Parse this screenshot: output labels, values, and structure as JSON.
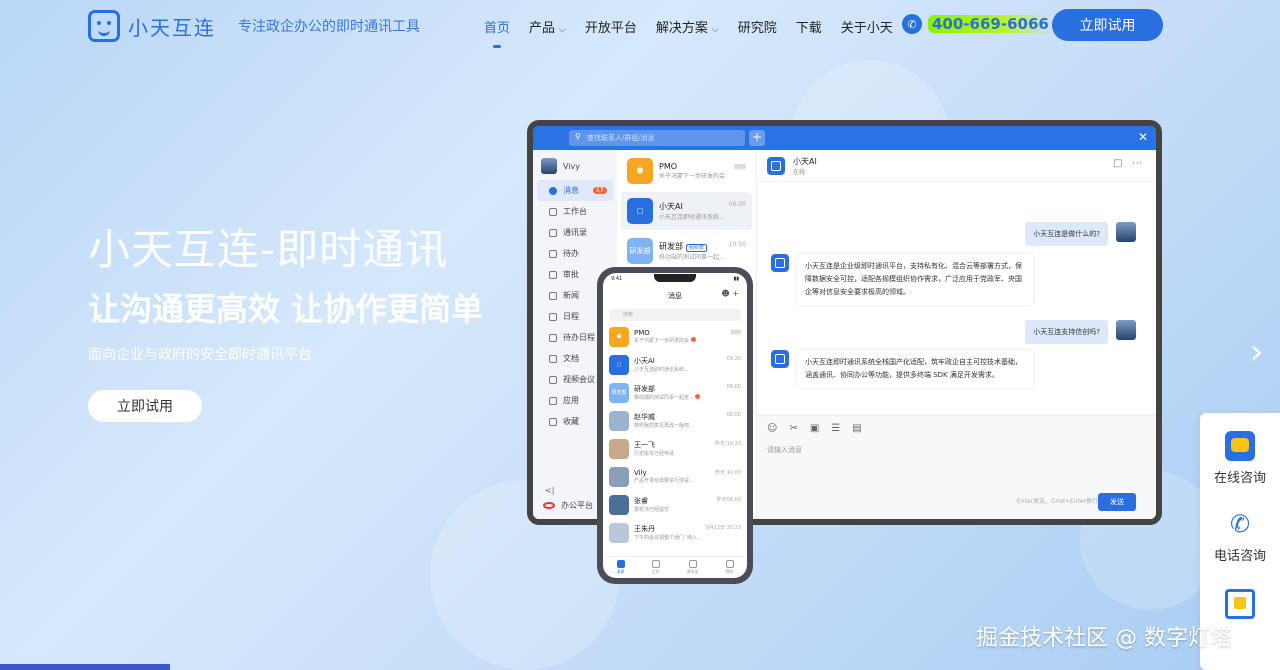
{
  "header": {
    "logo_text": "小天互连",
    "slogan": "专注政企办公的即时通讯工具",
    "nav": [
      {
        "label": "首页",
        "active": true
      },
      {
        "label": "产品",
        "dropdown": true
      },
      {
        "label": "开放平台"
      },
      {
        "label": "解决方案",
        "dropdown": true
      },
      {
        "label": "研究院"
      },
      {
        "label": "下载"
      },
      {
        "label": "关于小天"
      }
    ],
    "phone": "400-669-6066",
    "try_button": "立即试用"
  },
  "hero": {
    "title": "小天互连-即时通讯",
    "subtitle": "让沟通更高效 让协作更简单",
    "description": "面向企业与政府的安全即时通讯平台",
    "button": "立即试用"
  },
  "desktop": {
    "search_placeholder": "查找联系人/群组/消息",
    "user": "Vivy",
    "sidebar": [
      {
        "label": "消息",
        "badge": "17",
        "active": true
      },
      {
        "label": "工作台"
      },
      {
        "label": "通讯录"
      },
      {
        "label": "待办"
      },
      {
        "label": "审批"
      },
      {
        "label": "新闻"
      },
      {
        "label": "日程"
      },
      {
        "label": "待办日程"
      },
      {
        "label": "文档"
      },
      {
        "label": "视频会议"
      },
      {
        "label": "应用"
      },
      {
        "label": "收藏"
      }
    ],
    "collapse": "<|",
    "platform": "办公平台",
    "conversations": [
      {
        "name": "PMO",
        "time": "刚刚",
        "msg": "关于鸿蒙下一步研发的会",
        "color": "#f5a623"
      },
      {
        "name": "小天AI",
        "time": "09:20",
        "msg": "小天互连即时通讯系统...",
        "color": "#2a6fe0",
        "active": true
      },
      {
        "name": "研发部",
        "tag": "组织群",
        "time": "10:20",
        "msg": "移动端的测试同事一起...",
        "color": "#7fb4f2"
      }
    ],
    "chat": {
      "name": "小天AI",
      "status": "在线",
      "messages": [
        {
          "side": "right",
          "text": "小天互连是做什么的?"
        },
        {
          "side": "left",
          "text": "小天互连是企业级即时通讯平台，支持私有化、混合云等部署方式，保障数据安全可控，适配各规模组织协作需求，广泛应用于党政军、央国企等对信息安全要求极高的领域。"
        },
        {
          "side": "right",
          "text": "小天互连支持信创吗?"
        },
        {
          "side": "left",
          "text": "小天互连即时通讯系统全栈国产化适配，筑牢政企自主可控技术基础，涵盖通讯、协同办公等功能，提供多终端 SDK 满足开发需求。"
        }
      ],
      "input_placeholder": "请输入消息",
      "hint": "Enter发送，Cmd+Enter换行",
      "send": "发送"
    }
  },
  "mobile": {
    "time": "9:41",
    "title": "消息",
    "search": "搜索",
    "conversations": [
      {
        "name": "PMO",
        "time": "刚刚",
        "msg": "关于鸿蒙下一步研发的会",
        "color": "#f5a623",
        "dot": true
      },
      {
        "name": "小天AI",
        "time": "09:20",
        "msg": "小天互连即时通讯系统...",
        "color": "#2a6fe0"
      },
      {
        "name": "研发部",
        "time": "08:00",
        "msg": "移动端的测试同事一起走...",
        "color": "#7fb4f2",
        "dot": true
      },
      {
        "name": "赵华威",
        "time": "08:00",
        "msg": "按照我的意见再改一版吧...",
        "color": "#9bb3cf"
      },
      {
        "name": "王一飞",
        "time": "昨天 10:33",
        "msg": "历史版本已经申请",
        "color": "#c9a98a"
      },
      {
        "name": "Vily",
        "time": "昨天 10:00",
        "msg": "产品开发给需要进行测试...",
        "color": "#8aa0b8"
      },
      {
        "name": "张睿",
        "time": "昨天08:00",
        "msg": "报权书已经提交",
        "color": "#4c6f99"
      },
      {
        "name": "王朱丹",
        "time": "9月12日 20:23",
        "msg": "下午的会议调整个通门 '纳入...",
        "color": "#b9c8d6"
      }
    ],
    "tabs": [
      "消息",
      "工作",
      "通讯录",
      "我的"
    ]
  },
  "float_panel": {
    "items": [
      "在线咨询",
      "电话咨询"
    ]
  },
  "watermark": "掘金技术社区 @ 数字灯塔"
}
